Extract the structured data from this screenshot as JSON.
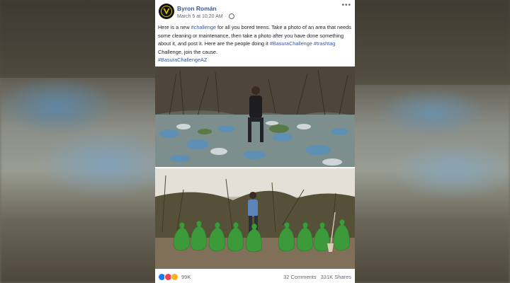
{
  "post": {
    "author": "Byron Román",
    "timestamp": "March 5 at 10:20 AM",
    "separator": "·",
    "more": "•••",
    "text_1": "Here is a new ",
    "tag_challenge": "#challenge",
    "text_2": " for all you bored teens. Take a photo of an area that needs some cleaning or maintenance, then take a photo after you have done something about it, and post it. Here are the people doing it ",
    "tag_basura": "#BasuraChallenge",
    "tag_trashtag": "#trashtag",
    "text_3": " Challenge, join the cause.",
    "tag_az": "#BasuraChallengeAZ"
  },
  "footer": {
    "reaction_count": "99K",
    "comments": "32 Comments",
    "shares": "331K Shares"
  },
  "icons": {
    "avatar": "v-logo-icon",
    "audience": "globe-icon"
  },
  "colors": {
    "link": "#385898",
    "text": "#1c1e21",
    "meta": "#606770",
    "trash_bags": "#3d9a3a"
  }
}
